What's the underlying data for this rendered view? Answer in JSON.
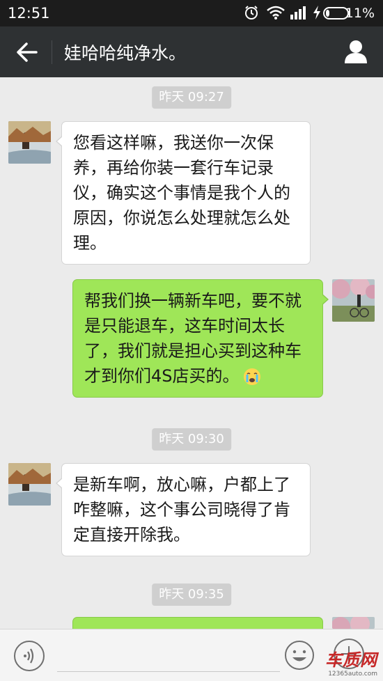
{
  "status_bar": {
    "time": "12:51",
    "battery": "11%"
  },
  "header": {
    "title": "娃哈哈纯净水。"
  },
  "messages": [
    {
      "type": "timestamp",
      "text": "昨天 09:27"
    },
    {
      "type": "incoming",
      "text": "您看这样嘛，我送你一次保养，再给你装一套行车记录仪，确实这个事情是我个人的原因，你说怎么处理就怎么处理。"
    },
    {
      "type": "outgoing",
      "text": "帮我们换一辆新车吧，要不就是只能退车，这车时间太长了，我们就是担心买到这种车才到你们4S店买的。",
      "emoji": "crying-face-icon"
    },
    {
      "type": "timestamp",
      "text": "昨天 09:30"
    },
    {
      "type": "incoming",
      "text": "是新车啊，放心嘛，户都上了咋整嘛，这个事公司晓得了肯定直接开除我。"
    },
    {
      "type": "timestamp",
      "text": "昨天 09:35"
    }
  ],
  "watermark": {
    "main": "车质网",
    "sub": "12365auto.com"
  },
  "colors": {
    "status_bar_bg": "#1c1c1c",
    "header_bg": "#2e3133",
    "chat_bg": "#ebebeb",
    "incoming_bubble": "#ffffff",
    "outgoing_bubble": "#9fe658",
    "timestamp_bg": "#cfcfcf"
  },
  "icons": [
    "alarm-icon",
    "wifi-icon",
    "signal-icon",
    "charging-icon",
    "battery-icon",
    "back-arrow-icon",
    "profile-icon",
    "voice-icon",
    "emoji-icon",
    "more-icon"
  ]
}
